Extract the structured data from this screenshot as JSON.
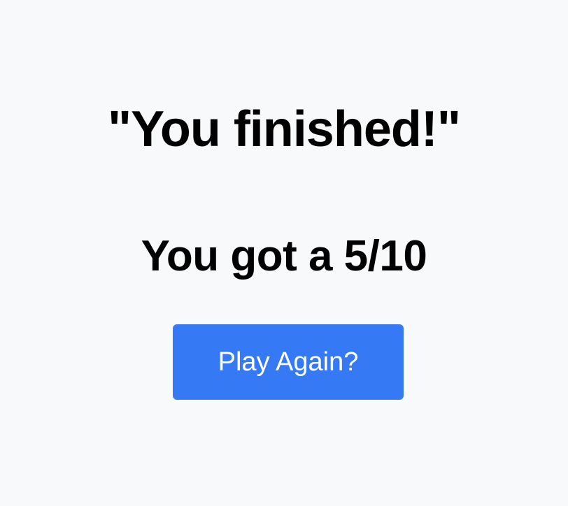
{
  "result": {
    "title": "\"You finished!\"",
    "score_text": "You got a 5/10"
  },
  "actions": {
    "play_again_label": "Play Again?"
  },
  "colors": {
    "background": "#f8f9fa",
    "button_background": "#3679f5",
    "button_text": "#ffffff",
    "text": "#000000"
  }
}
